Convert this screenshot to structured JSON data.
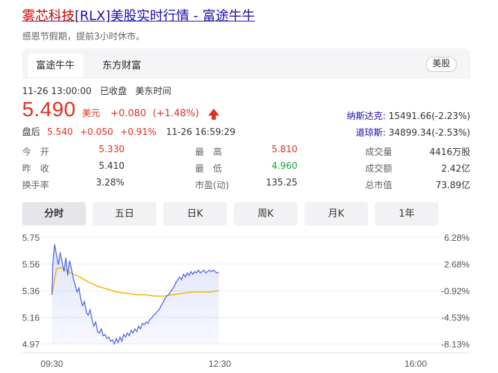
{
  "page": {
    "title_name": "雾芯科技",
    "title_rest": "[RLX]美股实时行情 - 富途牛牛",
    "notice": "感恩节假期，提前3小时休市。"
  },
  "source_tabs": [
    {
      "label": "富途牛牛",
      "active": true
    },
    {
      "label": "东方财富",
      "active": false
    }
  ],
  "market_badge": "美股",
  "status": {
    "datetime": "11-26 13:00:00",
    "state": "已收盘",
    "timezone": "美东时间"
  },
  "quote": {
    "price": "5.490",
    "currency": "美元",
    "change": "+0.080",
    "change_pct": "(+1.48%)",
    "trend": "up"
  },
  "after_hours": {
    "label": "盘后",
    "price": "5.540",
    "change": "+0.050",
    "change_pct": "+0.91%",
    "time": "11-26 16:59:29"
  },
  "indices": [
    {
      "name": "纳斯达克:",
      "value": "15491.66(-2.23%)"
    },
    {
      "name": "道琼斯:",
      "value": "34899.34(-2.53%)"
    }
  ],
  "stats": {
    "open": {
      "label": "今　开",
      "value": "5.330"
    },
    "high": {
      "label": "最　高",
      "value": "5.810"
    },
    "volume": {
      "label": "成交量",
      "value": "4416万股"
    },
    "prev_close": {
      "label": "昨　收",
      "value": "5.410"
    },
    "low": {
      "label": "最　低",
      "value": "4.960"
    },
    "turnover": {
      "label": "成交额",
      "value": "2.42亿"
    },
    "turnover_rate": {
      "label": "换手率",
      "value": "3.28%"
    },
    "pe": {
      "label": "市盈(动)",
      "value": "135.25"
    },
    "market_cap": {
      "label": "总市值",
      "value": "73.89亿"
    }
  },
  "period_tabs": [
    "分时",
    "五日",
    "日K",
    "周K",
    "月K",
    "1年"
  ],
  "active_period": "分时",
  "colors": {
    "up": "#e0301e",
    "down": "#1e9e3a",
    "price_line": "#4a63e0",
    "avg_line": "#f0b400",
    "link": "#1a0dab"
  },
  "chart_data": {
    "type": "line",
    "x_tick_labels": [
      "09:30",
      "12:30",
      "16:00"
    ],
    "y_tick_labels": [
      "5.75",
      "5.56",
      "5.36",
      "5.16",
      "4.97"
    ],
    "y_right_tick_labels": [
      "6.28%",
      "2.68%",
      "-0.92%",
      "-4.53%",
      "-8.13%"
    ],
    "ylim": [
      4.97,
      5.75
    ],
    "x_minutes_range": [
      0,
      390
    ],
    "series": [
      {
        "key": "price",
        "points": [
          [
            0,
            5.33
          ],
          [
            1,
            5.55
          ],
          [
            3,
            5.7
          ],
          [
            5,
            5.62
          ],
          [
            7,
            5.55
          ],
          [
            9,
            5.64
          ],
          [
            11,
            5.57
          ],
          [
            13,
            5.5
          ],
          [
            15,
            5.6
          ],
          [
            17,
            5.47
          ],
          [
            19,
            5.58
          ],
          [
            21,
            5.52
          ],
          [
            23,
            5.45
          ],
          [
            25,
            5.4
          ],
          [
            27,
            5.35
          ],
          [
            29,
            5.38
          ],
          [
            31,
            5.3
          ],
          [
            33,
            5.25
          ],
          [
            35,
            5.28
          ],
          [
            37,
            5.2
          ],
          [
            39,
            5.18
          ],
          [
            41,
            5.22
          ],
          [
            43,
            5.15
          ],
          [
            45,
            5.1
          ],
          [
            47,
            5.13
          ],
          [
            49,
            5.06
          ],
          [
            51,
            5.05
          ],
          [
            53,
            5.08
          ],
          [
            55,
            5.03
          ],
          [
            57,
            5.04
          ],
          [
            59,
            5.01
          ],
          [
            61,
            5.02
          ],
          [
            63,
            4.99
          ],
          [
            65,
            5.0
          ],
          [
            67,
            4.97
          ],
          [
            69,
            5.01
          ],
          [
            71,
            4.98
          ],
          [
            73,
            5.02
          ],
          [
            75,
            4.99
          ],
          [
            77,
            5.04
          ],
          [
            79,
            5.02
          ],
          [
            81,
            5.05
          ],
          [
            83,
            5.03
          ],
          [
            85,
            5.07
          ],
          [
            87,
            5.05
          ],
          [
            89,
            5.08
          ],
          [
            91,
            5.06
          ],
          [
            93,
            5.1
          ],
          [
            95,
            5.08
          ],
          [
            97,
            5.12
          ],
          [
            99,
            5.11
          ],
          [
            101,
            5.13
          ],
          [
            103,
            5.12
          ],
          [
            105,
            5.15
          ],
          [
            107,
            5.16
          ],
          [
            109,
            5.18
          ],
          [
            111,
            5.19
          ],
          [
            113,
            5.21
          ],
          [
            115,
            5.22
          ],
          [
            117,
            5.25
          ],
          [
            119,
            5.27
          ],
          [
            121,
            5.3
          ],
          [
            123,
            5.32
          ],
          [
            125,
            5.33
          ],
          [
            127,
            5.35
          ],
          [
            129,
            5.37
          ],
          [
            131,
            5.39
          ],
          [
            133,
            5.42
          ],
          [
            135,
            5.44
          ],
          [
            137,
            5.46
          ],
          [
            139,
            5.44
          ],
          [
            141,
            5.48
          ],
          [
            143,
            5.46
          ],
          [
            145,
            5.49
          ],
          [
            147,
            5.47
          ],
          [
            149,
            5.5
          ],
          [
            151,
            5.48
          ],
          [
            153,
            5.5
          ],
          [
            155,
            5.49
          ],
          [
            157,
            5.51
          ],
          [
            159,
            5.49
          ],
          [
            161,
            5.5
          ],
          [
            163,
            5.51
          ],
          [
            165,
            5.49
          ],
          [
            167,
            5.5
          ],
          [
            169,
            5.51
          ],
          [
            171,
            5.5
          ],
          [
            173,
            5.51
          ],
          [
            175,
            5.5
          ],
          [
            177,
            5.49
          ],
          [
            179,
            5.49
          ]
        ]
      },
      {
        "key": "average",
        "points": [
          [
            0,
            5.33
          ],
          [
            5,
            5.52
          ],
          [
            10,
            5.53
          ],
          [
            15,
            5.51
          ],
          [
            20,
            5.49
          ],
          [
            30,
            5.46
          ],
          [
            40,
            5.42
          ],
          [
            50,
            5.39
          ],
          [
            60,
            5.37
          ],
          [
            70,
            5.35
          ],
          [
            80,
            5.34
          ],
          [
            90,
            5.33
          ],
          [
            100,
            5.33
          ],
          [
            110,
            5.32
          ],
          [
            120,
            5.32
          ],
          [
            130,
            5.33
          ],
          [
            140,
            5.34
          ],
          [
            150,
            5.35
          ],
          [
            160,
            5.35
          ],
          [
            170,
            5.35
          ],
          [
            179,
            5.36
          ]
        ]
      }
    ],
    "grid": true
  }
}
